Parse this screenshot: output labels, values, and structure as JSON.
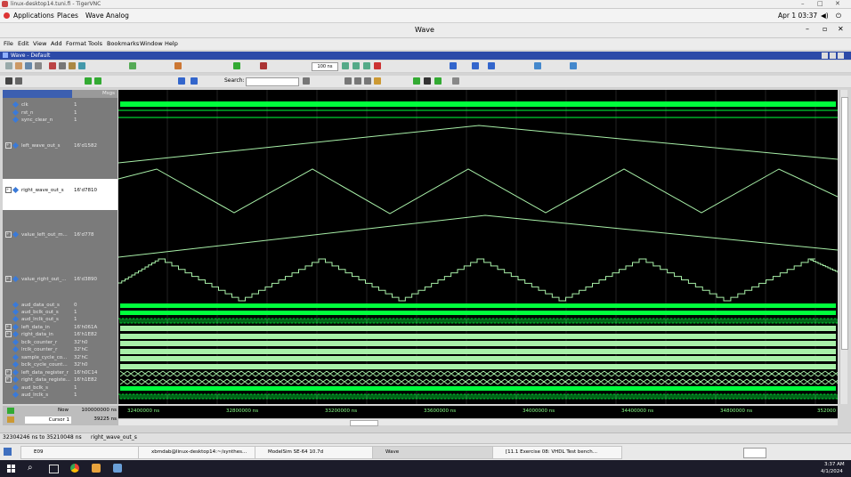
{
  "vnc": {
    "title": "linux-desktop14.tuni.fi - TigerVNC"
  },
  "gnome": {
    "applications": "Applications",
    "places": "Places",
    "app": "Wave Analog",
    "clock": "Apr 1 03:37"
  },
  "window": {
    "title": "Wave"
  },
  "menus": [
    "File",
    "Edit",
    "View",
    "Add",
    "Format",
    "Tools",
    "Bookmarks",
    "Window",
    "Help"
  ],
  "wave_pane": {
    "title": "Wave - Default"
  },
  "toolbar": {
    "run_length": "100 ns",
    "search_label": "Search:"
  },
  "columns": {
    "msgs": "Msgs"
  },
  "signals": [
    {
      "name": "clk",
      "value": "1"
    },
    {
      "name": "rst_n",
      "value": "1"
    },
    {
      "name": "sync_clear_n",
      "value": "1"
    },
    {
      "name": "left_wave_out_s",
      "value": "16'd1582"
    },
    {
      "name": "right_wave_out_s",
      "value": "16'd7810"
    },
    {
      "name": "value_left_out_m...",
      "value": "16'd778"
    },
    {
      "name": "value_right_out_...",
      "value": "16'd3890"
    },
    {
      "name": "aud_data_out_s",
      "value": "0"
    },
    {
      "name": "aud_bclk_out_s",
      "value": "1"
    },
    {
      "name": "aud_lrclk_out_s",
      "value": "1"
    },
    {
      "name": "left_data_in",
      "value": "16'h061A"
    },
    {
      "name": "right_data_in",
      "value": "16'h1E82"
    },
    {
      "name": "bclk_counter_r",
      "value": "32'h0"
    },
    {
      "name": "lrclk_counter_r",
      "value": "32'hC"
    },
    {
      "name": "sample_cycle_co...",
      "value": "32'hC"
    },
    {
      "name": "bclk_cycle_count...",
      "value": "32'h0"
    },
    {
      "name": "left_data_register_r",
      "value": "16'h0C14"
    },
    {
      "name": "right_data_registe...",
      "value": "16'h1E82"
    },
    {
      "name": "aud_bclk_s",
      "value": "1"
    },
    {
      "name": "aud_lrclk_s",
      "value": "1"
    }
  ],
  "cursor": {
    "now_label": "Now",
    "now_value": "100000000 ns",
    "cursor_label": "Cursor 1",
    "cursor_value": "39225 ns"
  },
  "timeline_ticks": [
    "32400000 ns",
    "32800000 ns",
    "33200000 ns",
    "33600000 ns",
    "34000000 ns",
    "34400000 ns",
    "34800000 ns",
    "352000"
  ],
  "status": {
    "range": "32304246 ns to 35210048 ns",
    "selected": "right_wave_out_s"
  },
  "taskbar": {
    "items": [
      "E09",
      "xbmdab@linux-desktop14:~/synthes...",
      "ModelSim SE-64 10.7d",
      "Wave",
      "[11.1 Exercise 08: VHDL Test bench..."
    ]
  },
  "windows_taskbar": {
    "time": "3:37 AM",
    "date": "4/1/2024"
  },
  "colors": {
    "wave": "#00ff3c",
    "analog": "#a8f0a8",
    "bg": "#000000",
    "titlebar": "#2c4aa8"
  }
}
